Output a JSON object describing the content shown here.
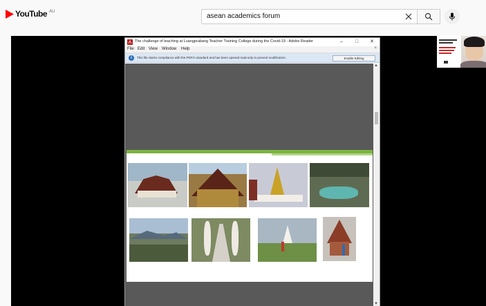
{
  "masthead": {
    "logo_text": "YouTube",
    "region": "AU",
    "search_value": "asean academics forum",
    "brand_color": "#ff0000"
  },
  "reader": {
    "title": "The challenge of teaching at Luangprabang Teacher Training College during the Covid-19 - Adobe Reader",
    "menu": [
      "File",
      "Edit",
      "View",
      "Window",
      "Help"
    ],
    "notice": "This file claims compliance with the PDF/A standard and has been opened read-only to prevent modification.",
    "enable_editing": "Enable Editing",
    "accent": "#7cb342"
  },
  "icons": {
    "search": "search-icon",
    "clear": "close-icon",
    "mic": "mic-icon",
    "pdf": "pdf-icon",
    "info": "info-icon"
  }
}
